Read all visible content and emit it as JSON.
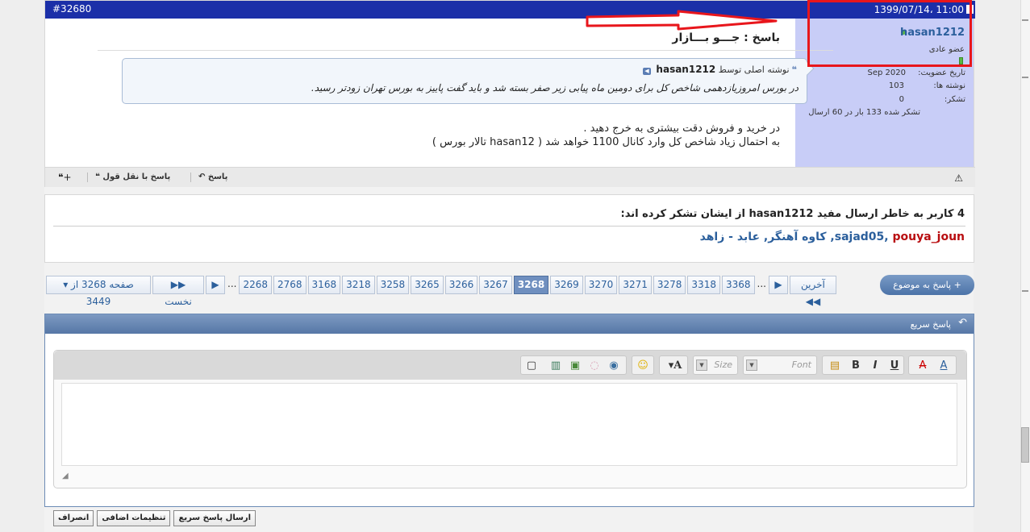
{
  "post": {
    "number": "#32680",
    "date": "1399/07/14، 11:00",
    "title": "باسخ : جـــو بـــازار",
    "quote": {
      "header_prefix": "نوشته اصلی توسط",
      "author": "hasan1212",
      "text": "در بورس امروزیازدهمی شاخص کل برای دومین ماه پیابی زیر صفر بسته شد و باید گفت پاییز به بورس تهران زودتر رسید."
    },
    "body_lines": [
      "در خرید و فروش دقت بیشتری به خرج دهید .",
      "به احتمال زیاد شاخص کل وارد کانال 1100 خواهد شد ( hasan12 تالار بورس )"
    ],
    "actions": {
      "reply": "پاسخ",
      "reply_quote": "پاسخ با نقل قول"
    }
  },
  "user": {
    "name": "hasan1212",
    "title": "عضو عادی",
    "join_label": "تاریخ عضویت:",
    "join_value": "Sep 2020",
    "posts_label": "نوشته ها:",
    "posts_value": "103",
    "thanks_label": "تشکر:",
    "thanks_value": "0",
    "thanked_text": "تشکر شده 133 بار در 60 ارسال"
  },
  "thanks": {
    "title": "4 کاربر به خاطر ارسال مفید hasan1212 از ایشان تشکر کرده اند:",
    "users": [
      {
        "name": "sajad05",
        "color": "#2b5f9c"
      },
      {
        "name": "pouya_joun",
        "color": "#b80d10"
      },
      {
        "name": "کاوه آهنگر",
        "color": "#2b5f9c"
      },
      {
        "name": "عابد - زاهد",
        "color": "#2b5f9c"
      }
    ]
  },
  "pager": {
    "page_info": "صفحه 3268 از 3449",
    "first": "نخست",
    "last": "آخرین",
    "pages": [
      "2268",
      "2768",
      "3168",
      "3218",
      "3258",
      "3265",
      "3266",
      "3267",
      "3268",
      "3269",
      "3270",
      "3271",
      "3278",
      "3318",
      "3368"
    ],
    "current": "3268"
  },
  "reply_button": "پاسخ به موضوع",
  "quick_reply": {
    "title": "پاسخ سریع",
    "font_placeholder": "Font",
    "size_placeholder": "Size",
    "buttons": {
      "submit": "ارسال پاسخ سریع",
      "advanced": "تنظیمات اضافی",
      "cancel": "انصراف"
    }
  },
  "colors": {
    "header_bar": "#1b2fa8",
    "userinfo_bg": "#c8cdf7",
    "highlight_red": "#e8161c",
    "link_blue": "#2b5f9c"
  }
}
